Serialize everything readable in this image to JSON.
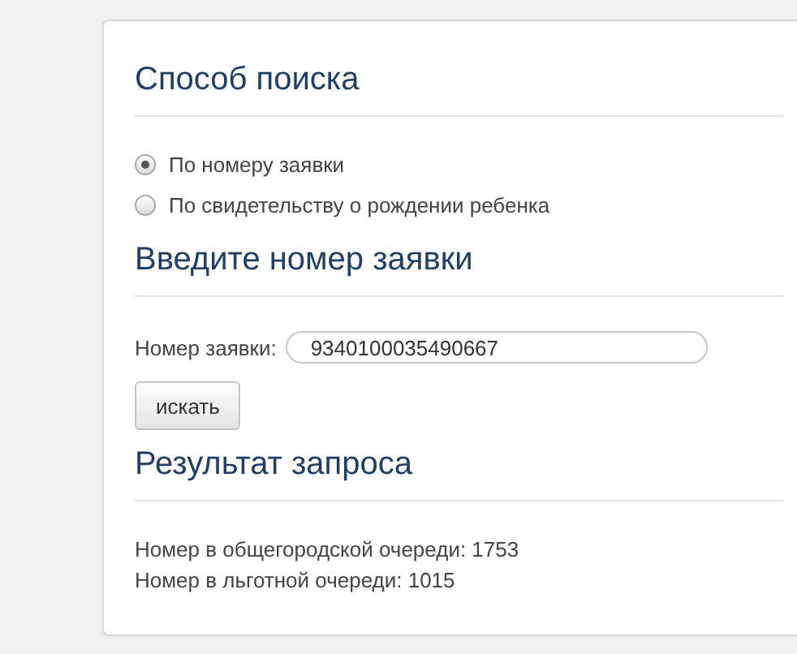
{
  "search_method": {
    "heading": "Способ поиска",
    "options": [
      {
        "label": "По номеру заявки",
        "selected": true
      },
      {
        "label": "По свидетельству о рождении ребенка",
        "selected": false
      }
    ]
  },
  "number_entry": {
    "heading": "Введите номер заявки",
    "label": "Номер заявки:",
    "value": "9340100035490667",
    "button": "искать"
  },
  "result": {
    "heading": "Результат запроса",
    "lines": [
      "Номер в общегородской очереди: 1753",
      "Номер в льготной очереди: 1015"
    ]
  }
}
